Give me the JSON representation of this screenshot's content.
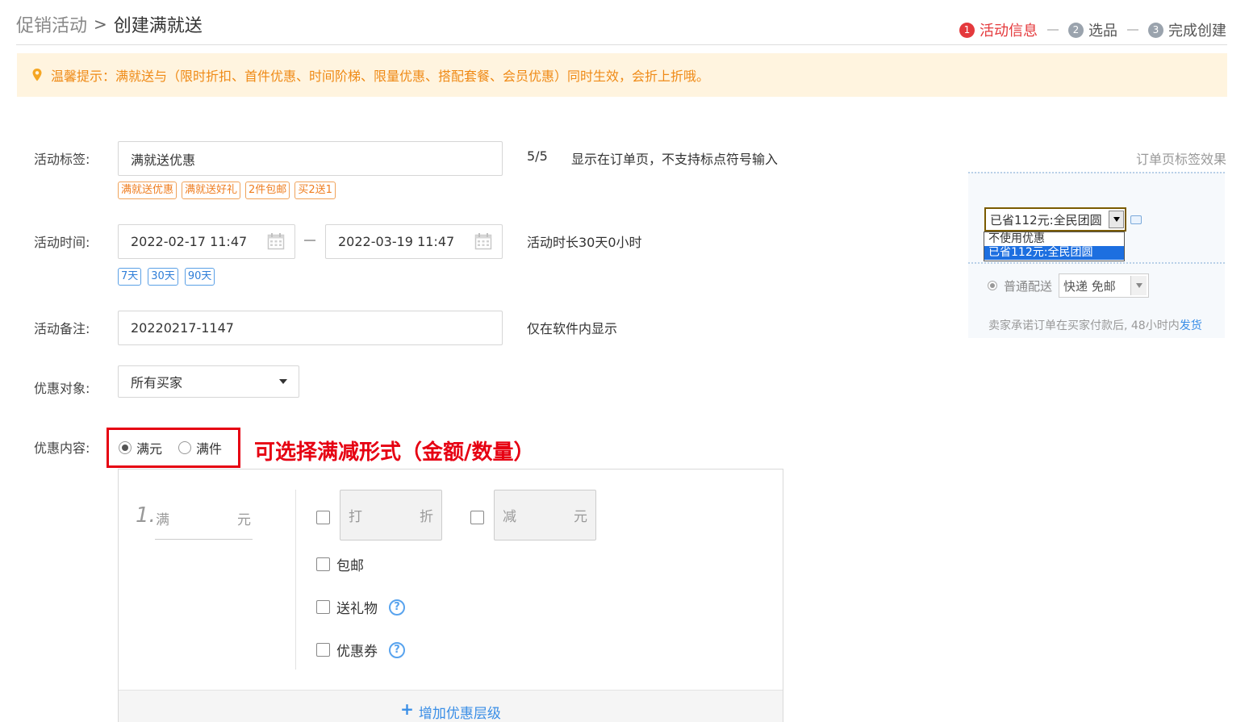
{
  "breadcrumb": {
    "parent": "促销活动",
    "separator": ">",
    "current": "创建满就送"
  },
  "steps": [
    {
      "num": "1",
      "label": "活动信息",
      "active": true
    },
    {
      "num": "2",
      "label": "选品",
      "active": false
    },
    {
      "num": "3",
      "label": "完成创建",
      "active": false
    }
  ],
  "notice": {
    "text": "温馨提示：满就送与（限时折扣、首件优惠、时间阶梯、限量优惠、搭配套餐、会员优惠）同时生效，会折上折哦。"
  },
  "form": {
    "tag_label": "活动标签:",
    "tag_value": "满就送优惠",
    "tag_count": "5/5",
    "tag_hint": "显示在订单页，不支持标点符号输入",
    "tag_presets": [
      "满就送优惠",
      "满就送好礼",
      "2件包邮",
      "买2送1"
    ],
    "time_label": "活动时间:",
    "start_time": "2022-02-17 11:47",
    "end_time": "2022-03-19 11:47",
    "duration_hint": "活动时长30天0小时",
    "duration_presets": [
      "7天",
      "30天",
      "90天"
    ],
    "remark_label": "活动备注:",
    "remark_value": "20220217-1147",
    "remark_hint": "仅在软件内显示",
    "target_label": "优惠对象:",
    "target_value": "所有买家",
    "content_label": "优惠内容:",
    "content_options": [
      {
        "label": "满元",
        "checked": true
      },
      {
        "label": "满件",
        "checked": false
      }
    ],
    "annotation": "可选择满减形式（金额/数量）"
  },
  "tier": {
    "index": "1.",
    "full_prefix": "满",
    "full_unit": "元",
    "discount_prefix": "打",
    "discount_unit": "折",
    "reduce_prefix": "减",
    "reduce_unit": "元",
    "free_shipping": "包邮",
    "gift": "送礼物",
    "coupon": "优惠券",
    "help_glyph": "?",
    "add_level_plus": "+",
    "add_level": "增加优惠层级"
  },
  "preview": {
    "title": "订单页标签效果",
    "selected": "已省112元:全民团圆",
    "options": [
      "不使用优惠",
      "已省112元:全民团圆"
    ],
    "shipping_label": "普通配送",
    "shipping_value": "快递 免邮",
    "footer_text": "卖家承诺订单在买家付款后, 48小时内",
    "footer_link": "发货"
  },
  "colors": {
    "accent_red": "#e4393c",
    "notice_bg": "#fff4df",
    "notice_text": "#ef8a16",
    "link_blue": "#3a8ee6",
    "annotation_red": "#e60012"
  }
}
